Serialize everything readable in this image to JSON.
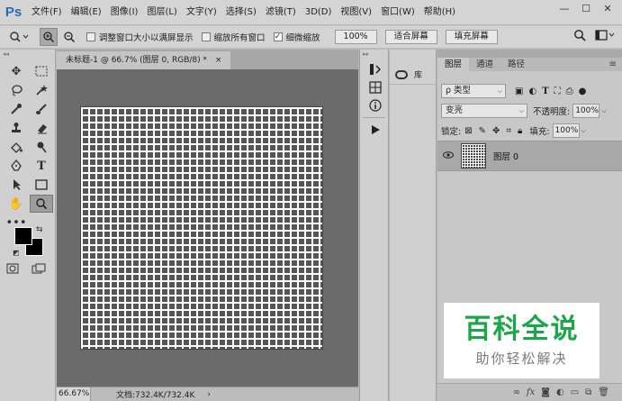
{
  "app": {
    "logo": "Ps"
  },
  "menu": [
    "文件(F)",
    "编辑(E)",
    "图像(I)",
    "图层(L)",
    "文字(Y)",
    "选择(S)",
    "滤镜(T)",
    "3D(D)",
    "视图(V)",
    "窗口(W)",
    "帮助(H)"
  ],
  "window_controls": {
    "minimize": "—",
    "restore": "☐",
    "close": "✕"
  },
  "options": {
    "resize_window": {
      "label": "调整窗口大小以满屏显示",
      "checked": false
    },
    "zoom_all": {
      "label": "缩放所有窗口",
      "checked": false
    },
    "scrubby_zoom": {
      "label": "细微缩放",
      "checked": true
    },
    "btn_100": "100%",
    "btn_fit": "适合屏幕",
    "btn_fill": "填充屏幕"
  },
  "document": {
    "tab_title": "未标题-1 @ 66.7% (图层 0, RGB/8) *",
    "tab_close": "×",
    "zoom": "66.67%",
    "doc_info": "文档:732.4K/732.4K"
  },
  "library": {
    "label": "库"
  },
  "layers_panel": {
    "tabs": [
      "图层",
      "通道",
      "路径"
    ],
    "filter_kind": "ρ 类型",
    "blend_mode": "变亮",
    "opacity_label": "不透明度:",
    "opacity_value": "100%",
    "lock_label": "锁定:",
    "fill_label": "填充:",
    "fill_value": "100%",
    "layers": [
      {
        "name": "图层 0",
        "visible": true
      }
    ]
  },
  "watermark": {
    "title": "百科全说",
    "subtitle": "助你轻松解决"
  },
  "colors": {
    "foreground": "#000000",
    "background": "#000000",
    "watermark_green": "#1ca64a"
  }
}
